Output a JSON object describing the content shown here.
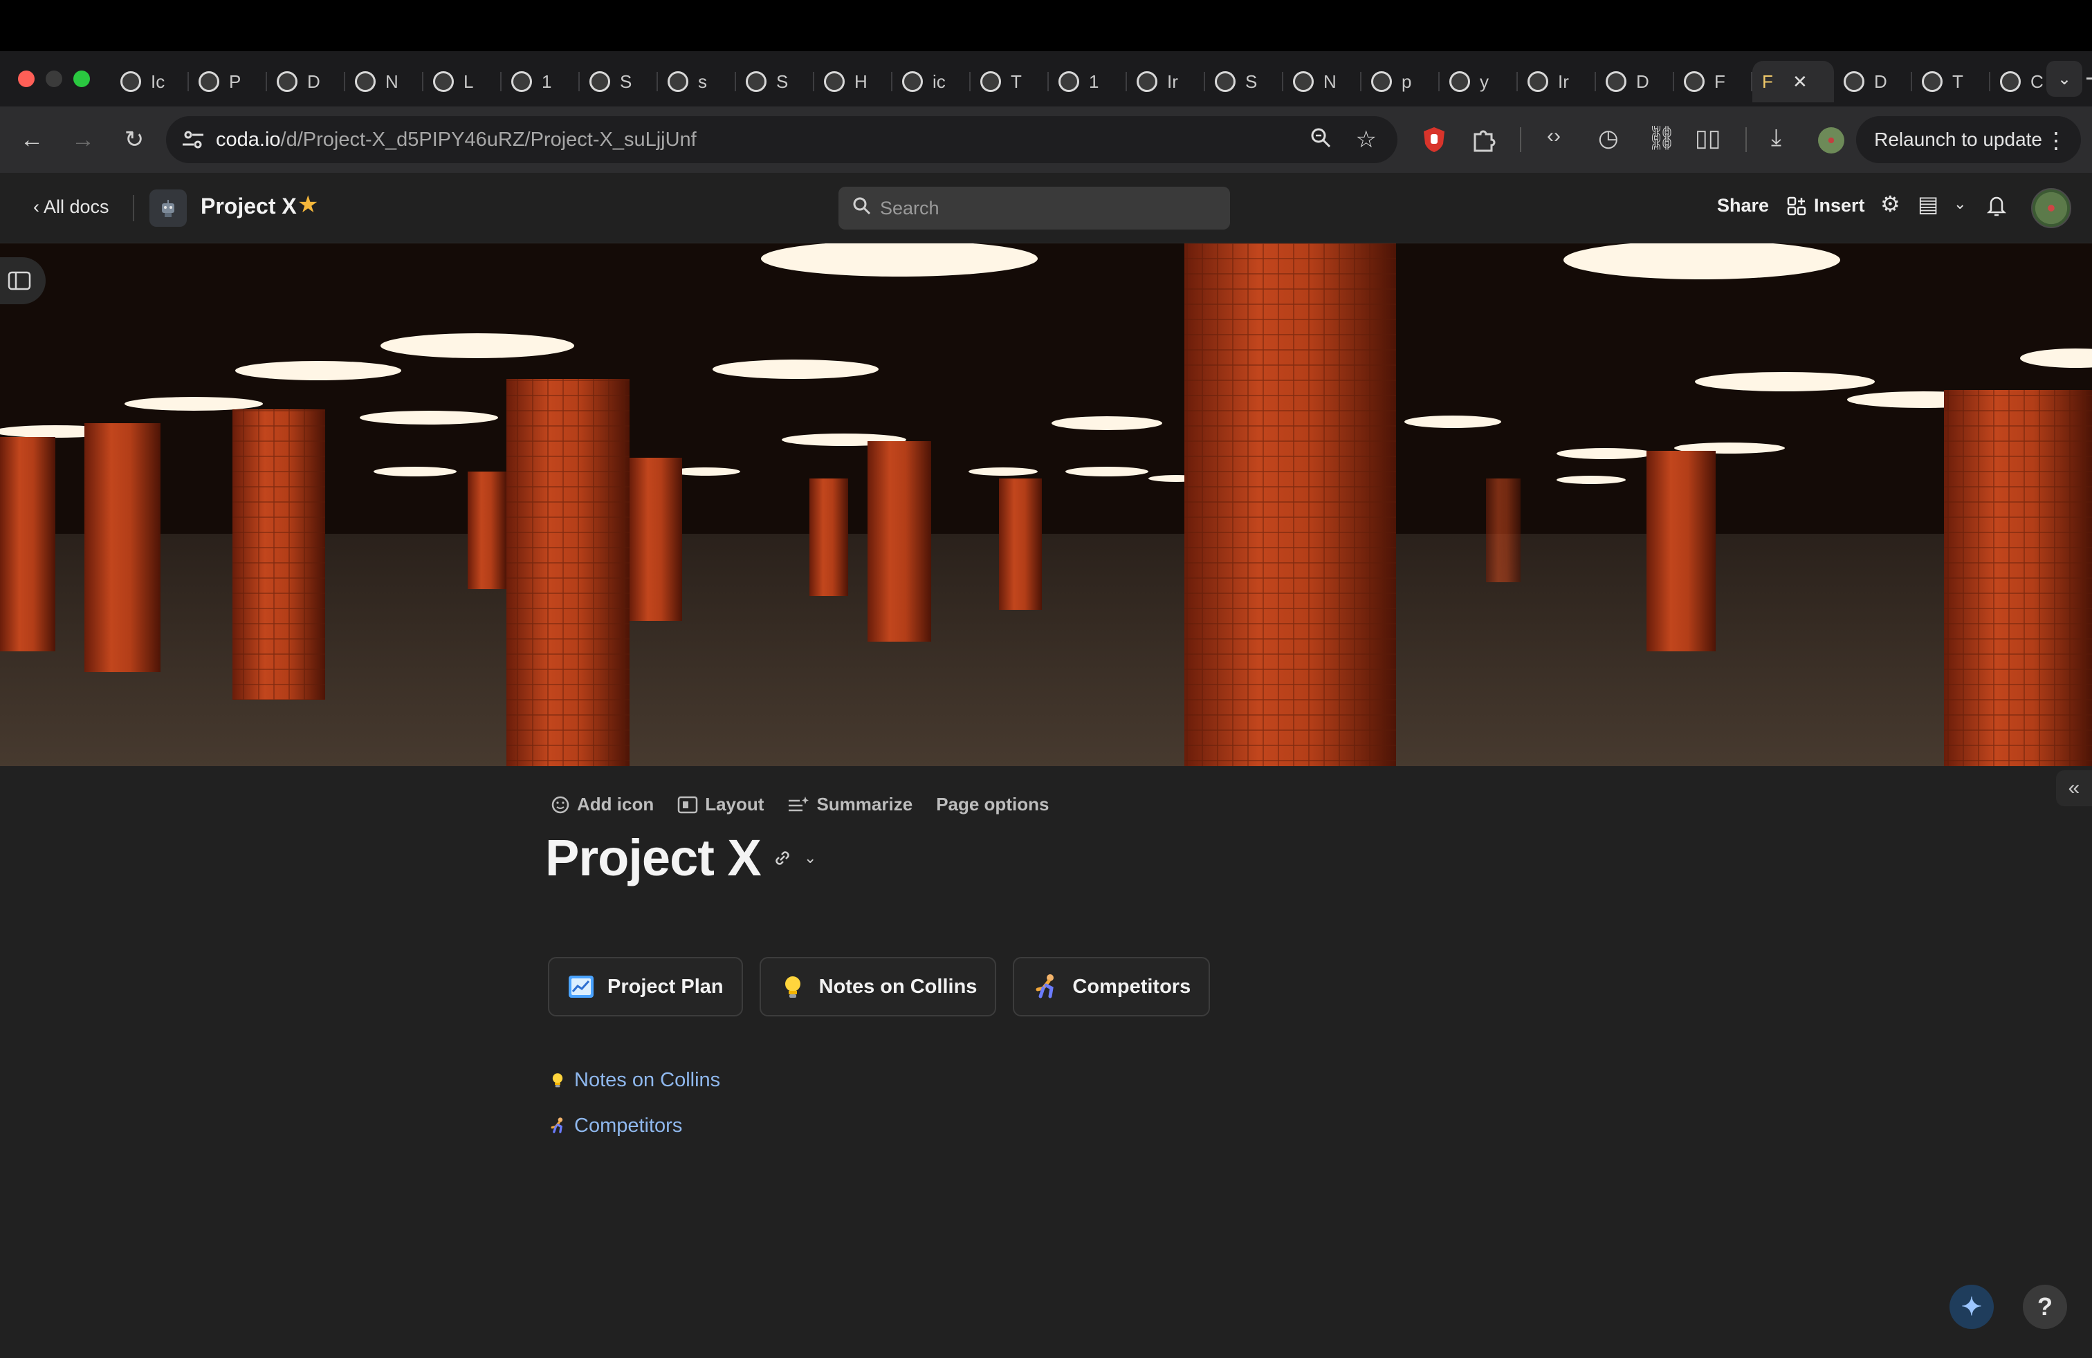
{
  "browser": {
    "tabs": [
      {
        "label": "Ic",
        "icon": "globe-icon"
      },
      {
        "label": "P",
        "icon": "puzzle-icon"
      },
      {
        "label": "D",
        "icon": "trello-icon"
      },
      {
        "label": "N",
        "icon": "nextjs-icon"
      },
      {
        "label": "L",
        "icon": "cube-icon"
      },
      {
        "label": "1",
        "icon": "shapes-icon"
      },
      {
        "label": "S",
        "icon": "globe-icon"
      },
      {
        "label": "s",
        "icon": "google-icon"
      },
      {
        "label": "S",
        "icon": "globe-icon"
      },
      {
        "label": "H",
        "icon": "half-circle-icon"
      },
      {
        "label": "ic",
        "icon": "crown-icon"
      },
      {
        "label": "T",
        "icon": "avatar-icon"
      },
      {
        "label": "1",
        "icon": "ui-icon"
      },
      {
        "label": "Ir",
        "icon": "tailwind-icon"
      },
      {
        "label": "S",
        "icon": "colorful-globe-icon"
      },
      {
        "label": "N",
        "icon": "chrome-icon"
      },
      {
        "label": "p",
        "icon": "triangle-icon"
      },
      {
        "label": "y",
        "icon": "github-icon"
      },
      {
        "label": "Ir",
        "icon": "tailwind-icon"
      },
      {
        "label": "D",
        "icon": "slash-icon"
      },
      {
        "label": "F",
        "icon": "globe-icon"
      }
    ],
    "active_tab": {
      "label": "F",
      "close": "✕"
    },
    "tabs_after": [
      {
        "label": "D",
        "icon": "download-icon"
      },
      {
        "label": "T",
        "icon": "globe-icon"
      },
      {
        "label": "C",
        "icon": "globe-icon"
      }
    ],
    "new_tab": "+",
    "url_host": "coda.io",
    "url_path": "/d/Project-X_d5PIPY46uRZ/Project-X_suLjjUnf",
    "relaunch_label": "Relaunch to update"
  },
  "header": {
    "all_docs": "‹ All docs",
    "doc_title": "Project X",
    "search_placeholder": "Search",
    "share": "Share",
    "insert": "Insert"
  },
  "page": {
    "actions": {
      "add_icon": "Add icon",
      "layout": "Layout",
      "summarize": "Summarize",
      "page_options": "Page options"
    },
    "title": "Project X",
    "cards": [
      {
        "label": "Project Plan",
        "icon": "chart-icon"
      },
      {
        "label": "Notes on Collins",
        "icon": "lightbulb-icon"
      },
      {
        "label": "Competitors",
        "icon": "runner-icon"
      }
    ],
    "links": [
      {
        "label": "Notes on Collins",
        "icon": "lightbulb-icon"
      },
      {
        "label": "Competitors",
        "icon": "runner-icon"
      }
    ],
    "help": "?"
  },
  "colors": {
    "background": "#212121",
    "link": "#8fb8ee",
    "star": "#f5b73b",
    "pillar": "#b8401c"
  }
}
